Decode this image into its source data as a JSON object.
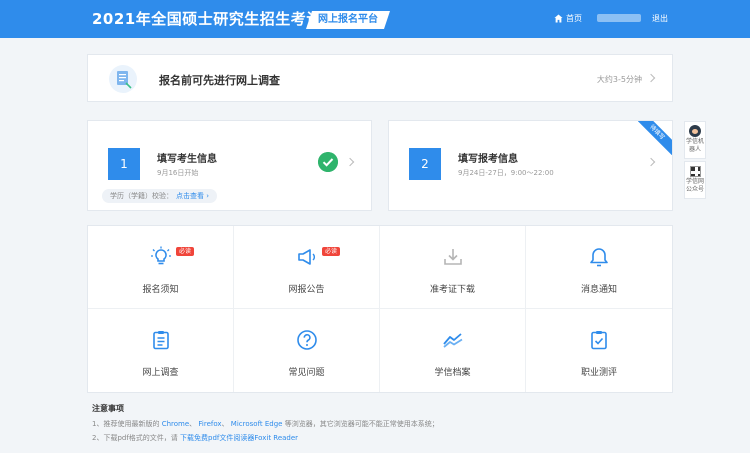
{
  "header": {
    "title": "2021年全国硕士研究生招生考试",
    "platform": "网上报名平台",
    "home": "首页",
    "logout": "退出"
  },
  "survey": {
    "title": "报名前可先进行网上调查",
    "duration": "大约3-5分钟"
  },
  "steps": [
    {
      "number": "1",
      "title": "填写考生信息",
      "date": "9月16日开始",
      "verify_label": "学历（学籍）校验：",
      "verify_link": "点击查看 ›",
      "status": "completed"
    },
    {
      "number": "2",
      "title": "填写报考信息",
      "date": "9月24日-27日，9:00～22:00",
      "ribbon": "待填写"
    }
  ],
  "side": {
    "robot_label": "学信机器人",
    "wechat_label": "学信网公众号"
  },
  "grid": [
    {
      "label": "报名须知",
      "icon": "bulb-icon",
      "badge": "必读"
    },
    {
      "label": "网报公告",
      "icon": "megaphone-icon",
      "badge": "必读"
    },
    {
      "label": "准考证下载",
      "icon": "download-icon",
      "badge": ""
    },
    {
      "label": "消息通知",
      "icon": "bell-icon",
      "badge": ""
    },
    {
      "label": "网上调查",
      "icon": "clipboard-icon",
      "badge": ""
    },
    {
      "label": "常见问题",
      "icon": "question-icon",
      "badge": ""
    },
    {
      "label": "学信档案",
      "icon": "archive-icon",
      "badge": ""
    },
    {
      "label": "职业测评",
      "icon": "checklist-icon",
      "badge": ""
    }
  ],
  "notes": {
    "title": "注意事项",
    "items": [
      {
        "prefix": "1、推荐使用最新版的 ",
        "b1": "Chrome",
        "sep1": "、 ",
        "b2": "Firefox",
        "sep2": "、 ",
        "b3": "Microsoft Edge",
        "suffix": " 等浏览器，其它浏览器可能不能正常使用本系统；"
      },
      {
        "prefix": "2、下载pdf格式的文件，请 ",
        "link": "下载免费pdf文件阅读器Foxit Reader",
        "suffix": ""
      }
    ]
  },
  "colors": {
    "primary": "#2f8ceb",
    "success": "#2fb46c",
    "badge": "#f0453a"
  }
}
